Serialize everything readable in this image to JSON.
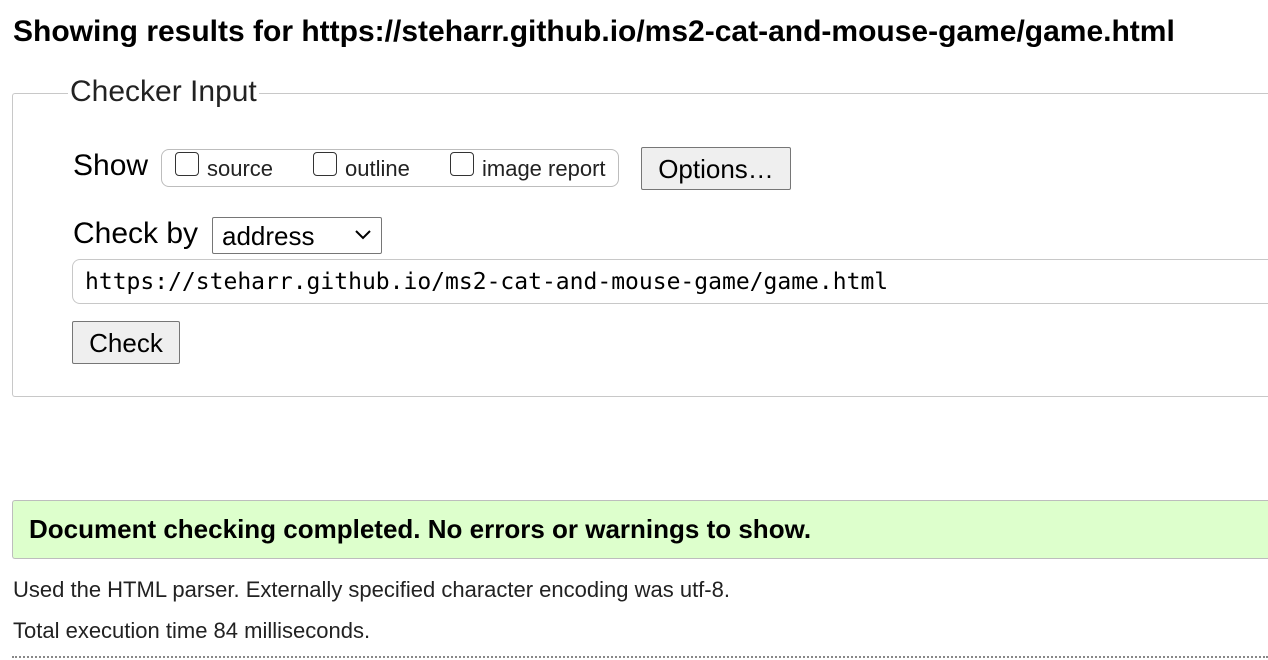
{
  "heading": "Showing results for https://steharr.github.io/ms2-cat-and-mouse-game/game.html",
  "checker_input": {
    "legend": "Checker Input",
    "show_label": "Show",
    "show_options": [
      {
        "label": "source",
        "checked": false
      },
      {
        "label": "outline",
        "checked": false
      },
      {
        "label": "image report",
        "checked": false
      }
    ],
    "options_button": "Options…",
    "check_by_label": "Check by",
    "check_by_selected": "address",
    "url_value": "https://steharr.github.io/ms2-cat-and-mouse-game/game.html",
    "check_button": "Check"
  },
  "result": {
    "message": "Document checking completed. No errors or warnings to show.",
    "status_color": "#ddffcc"
  },
  "info": {
    "parser": "Used the HTML parser. Externally specified character encoding was utf-8.",
    "execution_time": "Total execution time 84 milliseconds."
  },
  "icons": {
    "select_arrow": "chevron-down-icon"
  }
}
